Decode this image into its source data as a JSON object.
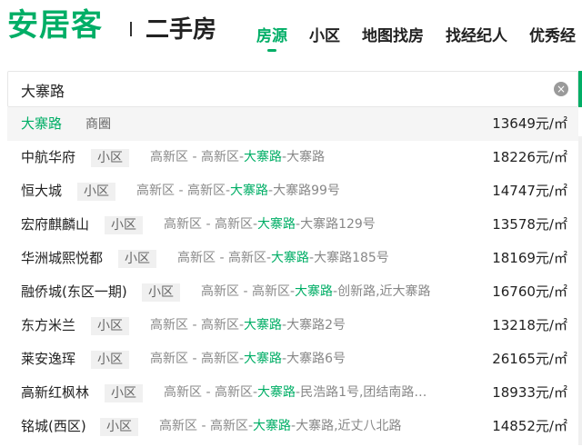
{
  "header": {
    "logo": "安居客",
    "subtitle": "二手房",
    "nav": [
      "房源",
      "小区",
      "地图找房",
      "找经纪人",
      "优秀经"
    ]
  },
  "search": {
    "value": "大寨路",
    "clear_icon": "×"
  },
  "suggestions": [
    {
      "name": "大寨路",
      "tag": "商圈",
      "addr_pre": "",
      "addr_hl": "",
      "addr_post": "",
      "price": "13649元/㎡"
    },
    {
      "name": "中航华府",
      "tag": "小区",
      "addr_pre": "高新区 - 高新区-",
      "addr_hl": "大寨路",
      "addr_post": "-大寨路",
      "price": "18226元/㎡"
    },
    {
      "name": "恒大城",
      "tag": "小区",
      "addr_pre": "高新区 - 高新区-",
      "addr_hl": "大寨路",
      "addr_post": "-大寨路99号",
      "price": "14747元/㎡"
    },
    {
      "name": "宏府麒麟山",
      "tag": "小区",
      "addr_pre": "高新区 - 高新区-",
      "addr_hl": "大寨路",
      "addr_post": "-大寨路129号",
      "price": "13578元/㎡"
    },
    {
      "name": "华洲城熙悦都",
      "tag": "小区",
      "addr_pre": "高新区 - 高新区-",
      "addr_hl": "大寨路",
      "addr_post": "-大寨路185号",
      "price": "18169元/㎡"
    },
    {
      "name": "融侨城(东区一期)",
      "tag": "小区",
      "addr_pre": "高新区 - 高新区-",
      "addr_hl": "大寨路",
      "addr_post": "-创新路,近大寨路",
      "price": "16760元/㎡"
    },
    {
      "name": "东方米兰",
      "tag": "小区",
      "addr_pre": "高新区 - 高新区-",
      "addr_hl": "大寨路",
      "addr_post": "-大寨路2号",
      "price": "13218元/㎡"
    },
    {
      "name": "莱安逸珲",
      "tag": "小区",
      "addr_pre": "高新区 - 高新区-",
      "addr_hl": "大寨路",
      "addr_post": "-大寨路6号",
      "price": "26165元/㎡"
    },
    {
      "name": "高新红枫林",
      "tag": "小区",
      "addr_pre": "高新区 - 高新区-",
      "addr_hl": "大寨路",
      "addr_post": "-民浩路1号,团结南路…",
      "price": "18933元/㎡"
    },
    {
      "name": "铭城(西区)",
      "tag": "小区",
      "addr_pre": "高新区 - 高新区-",
      "addr_hl": "大寨路",
      "addr_post": "-大寨路,近丈八北路",
      "price": "14852元/㎡"
    }
  ]
}
